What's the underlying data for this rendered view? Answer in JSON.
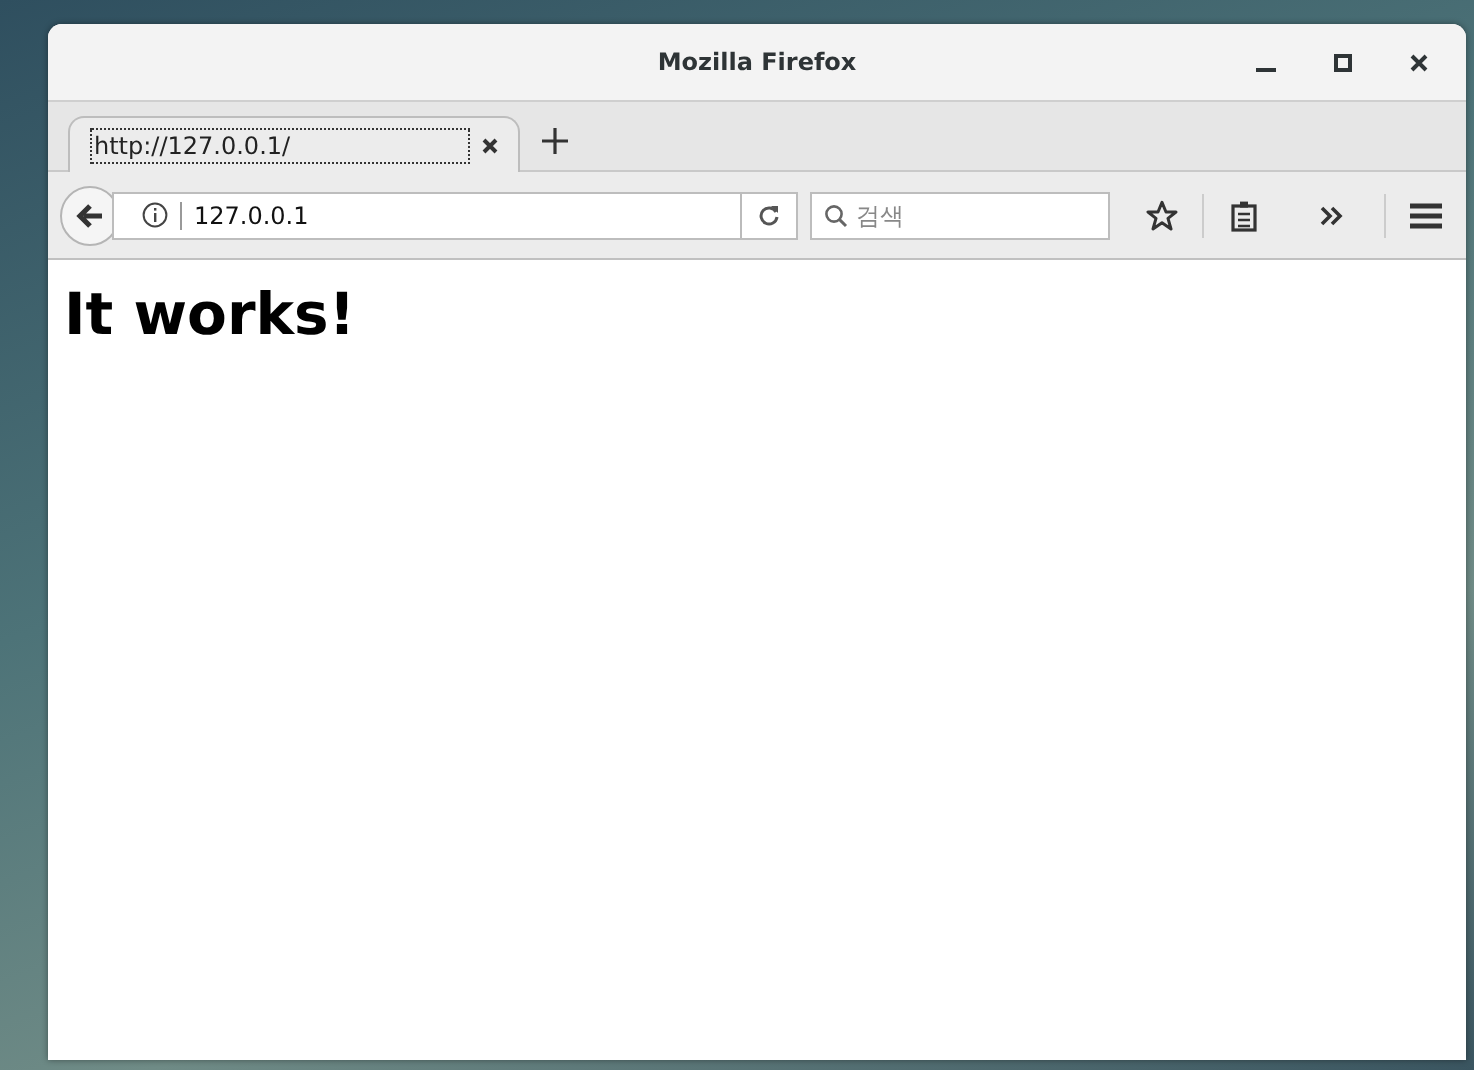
{
  "window": {
    "title": "Mozilla Firefox"
  },
  "tabs": [
    {
      "label": "http://127.0.0.1/",
      "selected": true
    }
  ],
  "address_bar": {
    "value": "127.0.0.1"
  },
  "search": {
    "placeholder": "검색"
  },
  "page": {
    "heading": "It works!"
  }
}
